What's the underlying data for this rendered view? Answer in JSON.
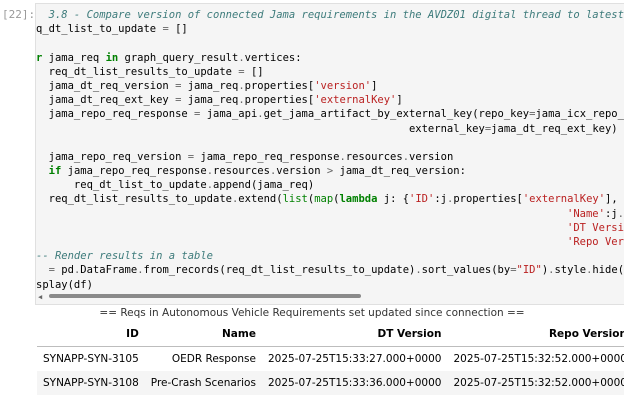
{
  "cell": {
    "prompt": "[22]:",
    "lines": [
      [
        {
          "t": "  3.8 - Compare version of connected Jama requirements in the AVDZ01 digital thread to latest versio",
          "c": "cm"
        }
      ],
      [
        {
          "t": "q_dt_list_to_update ",
          "c": ""
        },
        {
          "t": "=",
          "c": "op"
        },
        {
          "t": " []",
          "c": ""
        }
      ],
      [
        {
          "t": "",
          "c": ""
        }
      ],
      [
        {
          "t": "r ",
          "c": "kw"
        },
        {
          "t": "jama_req ",
          "c": ""
        },
        {
          "t": "in",
          "c": "kw"
        },
        {
          "t": " graph_query_result",
          "c": ""
        },
        {
          "t": ".",
          "c": "op"
        },
        {
          "t": "vertices:",
          "c": ""
        }
      ],
      [
        {
          "t": "  req_dt_list_results_to_update ",
          "c": ""
        },
        {
          "t": "=",
          "c": "op"
        },
        {
          "t": " []",
          "c": ""
        }
      ],
      [
        {
          "t": "  jama_dt_req_version ",
          "c": ""
        },
        {
          "t": "=",
          "c": "op"
        },
        {
          "t": " jama_req",
          "c": ""
        },
        {
          "t": ".",
          "c": "op"
        },
        {
          "t": "properties[",
          "c": ""
        },
        {
          "t": "'version'",
          "c": "st"
        },
        {
          "t": "]",
          "c": ""
        }
      ],
      [
        {
          "t": "  jama_dt_req_ext_key ",
          "c": ""
        },
        {
          "t": "=",
          "c": "op"
        },
        {
          "t": " jama_req",
          "c": ""
        },
        {
          "t": ".",
          "c": "op"
        },
        {
          "t": "properties[",
          "c": ""
        },
        {
          "t": "'externalKey'",
          "c": "st"
        },
        {
          "t": "]",
          "c": ""
        }
      ],
      [
        {
          "t": "  jama_repo_req_response ",
          "c": ""
        },
        {
          "t": "=",
          "c": "op"
        },
        {
          "t": " jama_api",
          "c": ""
        },
        {
          "t": ".",
          "c": "op"
        },
        {
          "t": "get_jama_artifact_by_external_key(repo_key",
          "c": ""
        },
        {
          "t": "=",
          "c": "op"
        },
        {
          "t": "jama_icx_repo_key,us",
          "c": ""
        }
      ],
      [
        {
          "t": "                                                           external_key",
          "c": ""
        },
        {
          "t": "=",
          "c": "op"
        },
        {
          "t": "jama_dt_req_ext_key)",
          "c": ""
        }
      ],
      [
        {
          "t": "",
          "c": ""
        }
      ],
      [
        {
          "t": "  jama_repo_req_version ",
          "c": ""
        },
        {
          "t": "=",
          "c": "op"
        },
        {
          "t": " jama_repo_req_response",
          "c": ""
        },
        {
          "t": ".",
          "c": "op"
        },
        {
          "t": "resources",
          "c": ""
        },
        {
          "t": ".",
          "c": "op"
        },
        {
          "t": "version",
          "c": ""
        }
      ],
      [
        {
          "t": "  if",
          "c": "kw"
        },
        {
          "t": " jama_repo_req_response",
          "c": ""
        },
        {
          "t": ".",
          "c": "op"
        },
        {
          "t": "resources",
          "c": ""
        },
        {
          "t": ".",
          "c": "op"
        },
        {
          "t": "version ",
          "c": ""
        },
        {
          "t": ">",
          "c": "op"
        },
        {
          "t": " jama_dt_req_version:",
          "c": ""
        }
      ],
      [
        {
          "t": "      req_dt_list_to_update",
          "c": ""
        },
        {
          "t": ".",
          "c": "op"
        },
        {
          "t": "append(jama_req)",
          "c": ""
        }
      ],
      [
        {
          "t": "  req_dt_list_results_to_update",
          "c": ""
        },
        {
          "t": ".",
          "c": "op"
        },
        {
          "t": "extend(",
          "c": ""
        },
        {
          "t": "list",
          "c": "nb"
        },
        {
          "t": "(",
          "c": ""
        },
        {
          "t": "map",
          "c": "nb"
        },
        {
          "t": "(",
          "c": ""
        },
        {
          "t": "lambda",
          "c": "kw"
        },
        {
          "t": " j: {",
          "c": ""
        },
        {
          "t": "'ID'",
          "c": "st"
        },
        {
          "t": ":j",
          "c": ""
        },
        {
          "t": ".",
          "c": "op"
        },
        {
          "t": "properties[",
          "c": ""
        },
        {
          "t": "'externalKey'",
          "c": "st"
        },
        {
          "t": "],",
          "c": ""
        }
      ],
      [
        {
          "t": "                                                                                    ",
          "c": ""
        },
        {
          "t": "'Name'",
          "c": "st"
        },
        {
          "t": ":j",
          "c": ""
        },
        {
          "t": ".",
          "c": "op"
        },
        {
          "t": "properties[",
          "c": ""
        },
        {
          "t": "'na",
          "c": "st"
        }
      ],
      [
        {
          "t": "                                                                                    ",
          "c": ""
        },
        {
          "t": "'DT Version'",
          "c": "st"
        },
        {
          "t": ":j",
          "c": ""
        },
        {
          "t": ".",
          "c": "op"
        },
        {
          "t": "properti",
          "c": ""
        }
      ],
      [
        {
          "t": "                                                                                    ",
          "c": ""
        },
        {
          "t": "'Repo Version'",
          "c": "st"
        },
        {
          "t": ":jama_rep",
          "c": ""
        }
      ],
      [
        {
          "t": "-- Render results in a table",
          "c": "cm"
        }
      ],
      [
        {
          "t": "  = ",
          "c": "op"
        },
        {
          "t": "pd",
          "c": ""
        },
        {
          "t": ".",
          "c": "op"
        },
        {
          "t": "DataFrame",
          "c": ""
        },
        {
          "t": ".",
          "c": "op"
        },
        {
          "t": "from_records(req_dt_list_results_to_update)",
          "c": ""
        },
        {
          "t": ".",
          "c": "op"
        },
        {
          "t": "sort_values(by",
          "c": ""
        },
        {
          "t": "=",
          "c": "op"
        },
        {
          "t": "\"ID\"",
          "c": "st"
        },
        {
          "t": ")",
          "c": ""
        },
        {
          "t": ".",
          "c": "op"
        },
        {
          "t": "style",
          "c": ""
        },
        {
          "t": ".",
          "c": "op"
        },
        {
          "t": "hide(axis",
          "c": ""
        },
        {
          "t": "=",
          "c": "op"
        },
        {
          "t": "'i",
          "c": "st"
        }
      ],
      [
        {
          "t": "splay(df)",
          "c": ""
        }
      ]
    ]
  },
  "scrollbar": {
    "left_arrow": "◀"
  },
  "output": {
    "title": "== Reqs in Autonomous Vehicle Requirements set updated since connection ==",
    "columns": [
      "ID",
      "Name",
      "DT Version",
      "Repo Version"
    ],
    "rows": [
      [
        "SYNAPP-SYN-3105",
        "OEDR Response",
        "2025-07-25T15:33:27.000+0000",
        "2025-07-25T15:32:52.000+0000"
      ],
      [
        "SYNAPP-SYN-3108",
        "Pre-Crash Scenarios",
        "2025-07-25T15:33:36.000+0000",
        "2025-07-25T15:32:52.000+0000"
      ]
    ]
  }
}
